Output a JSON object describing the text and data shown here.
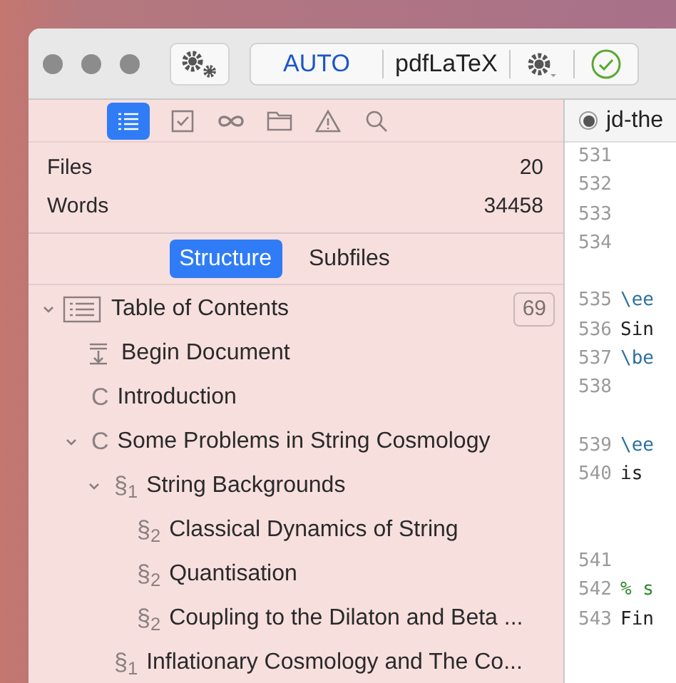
{
  "toolbar": {
    "engine_mode": "AUTO",
    "engine": "pdfLaTeX",
    "status_ok": true
  },
  "sidebar": {
    "tabs": [
      {
        "kind": "outline",
        "selected": true
      },
      {
        "kind": "tasks",
        "selected": false
      },
      {
        "kind": "links",
        "selected": false
      },
      {
        "kind": "files",
        "selected": false
      },
      {
        "kind": "warnings",
        "selected": false
      },
      {
        "kind": "search",
        "selected": false
      }
    ],
    "stats": [
      {
        "label": "Files",
        "value": "20"
      },
      {
        "label": "Words",
        "value": "34458"
      }
    ],
    "views": [
      {
        "label": "Structure",
        "selected": true
      },
      {
        "label": "Subfiles",
        "selected": false
      }
    ],
    "tree": [
      {
        "kind": "toc",
        "title": "Table of Contents",
        "count": "69",
        "expanded": true,
        "children": [
          {
            "kind": "begin",
            "title": "Begin Document"
          },
          {
            "kind": "section",
            "marker": "C",
            "title": "Introduction"
          },
          {
            "kind": "section",
            "marker": "C",
            "title": "Some Problems in String Cosmology",
            "expanded": true,
            "children": [
              {
                "kind": "section",
                "marker": "§$_{1}$",
                "title": "String Backgrounds",
                "expanded": true,
                "children": [
                  {
                    "kind": "section",
                    "marker": "§$_{2}$",
                    "title": "Classical Dynamics of String"
                  },
                  {
                    "kind": "section",
                    "marker": "§$_{2}$",
                    "title": "Quantisation"
                  },
                  {
                    "kind": "section",
                    "marker": "§$_{2}$",
                    "title": "Coupling to the Dilaton and Beta ..."
                  }
                ]
              },
              {
                "kind": "section",
                "marker": "§$_{1}$",
                "title": "Inflationary Cosmology and The Co..."
              }
            ]
          }
        ]
      }
    ]
  },
  "editor": {
    "tab": {
      "title": "jd-the",
      "modified": true
    },
    "lines": [
      {
        "kind": "blank",
        "number": "531"
      },
      {
        "kind": "blank",
        "number": "532"
      },
      {
        "kind": "blank",
        "number": "533"
      },
      {
        "kind": "blank",
        "number": "534"
      },
      {
        "kind": "continuation"
      },
      {
        "kind": "command",
        "number": "535",
        "text": "\\ee"
      },
      {
        "kind": "plain",
        "number": "536",
        "text": "Sin"
      },
      {
        "kind": "command",
        "number": "537",
        "text": "\\be"
      },
      {
        "kind": "blank",
        "number": "538"
      },
      {
        "kind": "continuation"
      },
      {
        "kind": "command",
        "number": "539",
        "text": "\\ee"
      },
      {
        "kind": "plain",
        "number": "540",
        "text": "is"
      },
      {
        "kind": "continuation"
      },
      {
        "kind": "continuation"
      },
      {
        "kind": "blank",
        "number": "541"
      },
      {
        "kind": "comment",
        "number": "542",
        "text": "% s"
      },
      {
        "kind": "plain",
        "number": "543",
        "text": "Fin"
      }
    ]
  }
}
